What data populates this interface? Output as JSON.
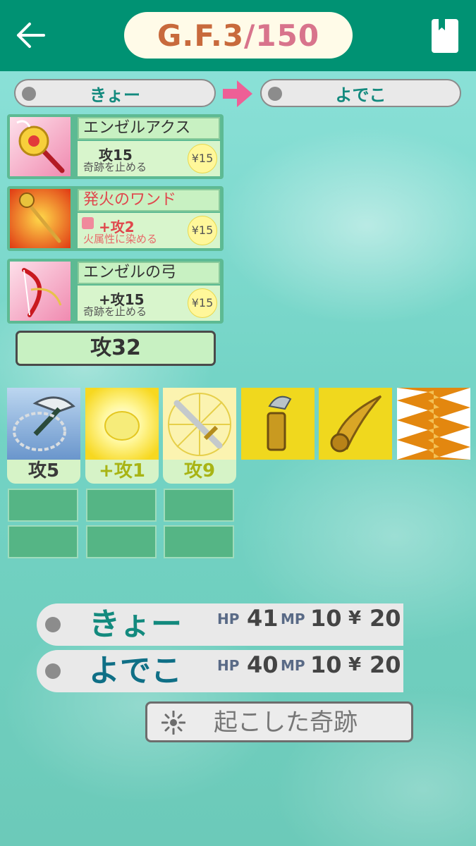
{
  "header": {
    "back_icon": "back-arrow-icon",
    "title_prefix": "G.F.3",
    "title_suffix": " /150",
    "book_icon": "bookmark-book-icon"
  },
  "players_top": {
    "from": "きょー",
    "to": "よでこ",
    "arrow_icon": "right-arrow-icon"
  },
  "items": [
    {
      "name": "エンゼルアクス",
      "stat": "攻15",
      "desc": "奇跡を止める",
      "price": "¥15"
    },
    {
      "name": "発火のワンド",
      "stat": "+攻2",
      "desc": "火属性に染める",
      "price": "¥15"
    },
    {
      "name": "エンゼルの弓",
      "stat": "+攻15",
      "desc": "奇跡を止める",
      "price": "¥15"
    }
  ],
  "total_attack": "攻32",
  "inventory": [
    {
      "icon": "chain-axe-icon",
      "label": "攻5"
    },
    {
      "icon": "glowing-orb-icon",
      "label": "+攻1"
    },
    {
      "icon": "holy-sword-icon",
      "label": "攻9"
    },
    {
      "icon": "golden-crystal-icon"
    },
    {
      "icon": "golden-horn-icon"
    },
    {
      "icon": "flame-wave-icon"
    }
  ],
  "status": [
    {
      "name": "きょー",
      "hp_label": "HP",
      "hp": "41",
      "mp_label": "MP",
      "mp": "10",
      "yen_label": "¥",
      "yen": "20"
    },
    {
      "name": "よでこ",
      "hp_label": "HP",
      "hp": "40",
      "mp_label": "MP",
      "mp": "10",
      "yen_label": "¥",
      "yen": "20"
    }
  ],
  "miracle_button": {
    "label": "起こした奇跡",
    "icon": "sparkle-icon"
  }
}
